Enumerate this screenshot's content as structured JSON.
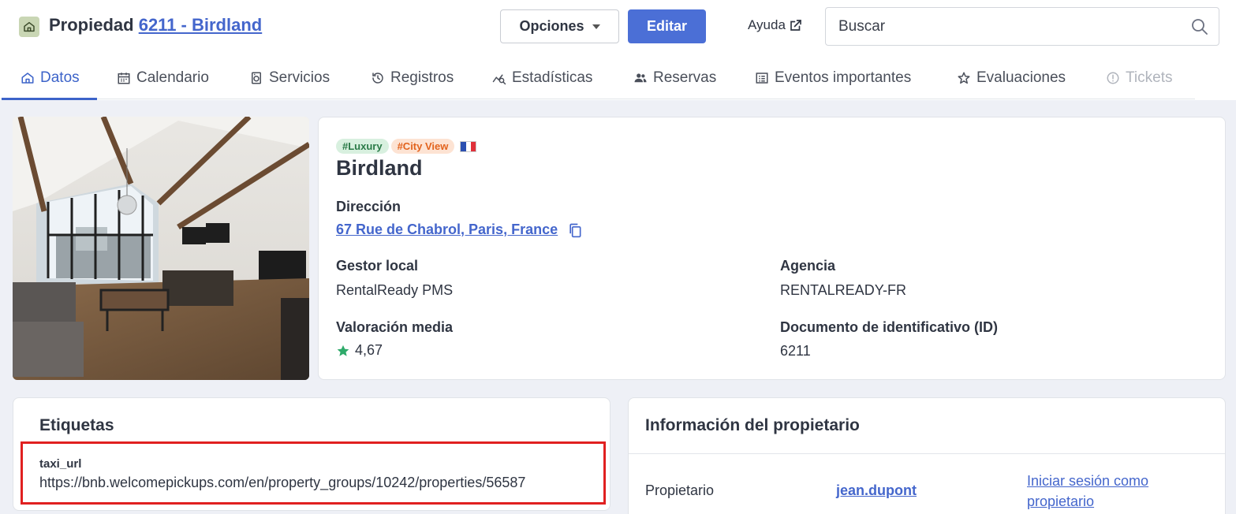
{
  "header": {
    "title_prefix": "Propiedad",
    "title_link": "6211 - Birdland",
    "options_label": "Opciones",
    "edit_label": "Editar",
    "help_label": "Ayuda",
    "search_placeholder": "Buscar"
  },
  "tabs": [
    {
      "label": "Datos",
      "icon": "home-icon",
      "state": "active"
    },
    {
      "label": "Calendario",
      "icon": "calendar-icon",
      "state": "normal"
    },
    {
      "label": "Servicios",
      "icon": "laundry-icon",
      "state": "normal"
    },
    {
      "label": "Registros",
      "icon": "history-icon",
      "state": "normal"
    },
    {
      "label": "Estadísticas",
      "icon": "analytics-icon",
      "state": "normal"
    },
    {
      "label": "Reservas",
      "icon": "people-icon",
      "state": "normal"
    },
    {
      "label": "Eventos importantes",
      "icon": "event-list-icon",
      "state": "normal"
    },
    {
      "label": "Evaluaciones",
      "icon": "star-outline-icon",
      "state": "normal"
    },
    {
      "label": "Tickets",
      "icon": "alert-circle-icon",
      "state": "disabled"
    }
  ],
  "property": {
    "tags": [
      "#Luxury",
      "#City View"
    ],
    "flag": "france-flag-icon",
    "name": "Birdland",
    "address_label": "Dirección",
    "address": "67 Rue de Chabrol, Paris, France",
    "manager_label": "Gestor local",
    "manager": "RentalReady PMS",
    "agency_label": "Agencia",
    "agency": "RENTALREADY-FR",
    "rating_label": "Valoración media",
    "rating": "4,67",
    "id_label": "Documento de identificativo (ID)",
    "id": "6211"
  },
  "labels_card": {
    "title": "Etiquetas",
    "key": "taxi_url",
    "value": "https://bnb.welcomepickups.com/en/property_groups/10242/properties/56587"
  },
  "owner_card": {
    "title": "Información del propietario",
    "owner_label": "Propietario",
    "owner_name": "jean.dupont",
    "login_action": "Iniciar sesión como propietario"
  },
  "colors": {
    "primary": "#4b6fd6",
    "link": "#4466cc",
    "highlight_border": "#e02020",
    "rating_star": "#2eaa6a"
  }
}
